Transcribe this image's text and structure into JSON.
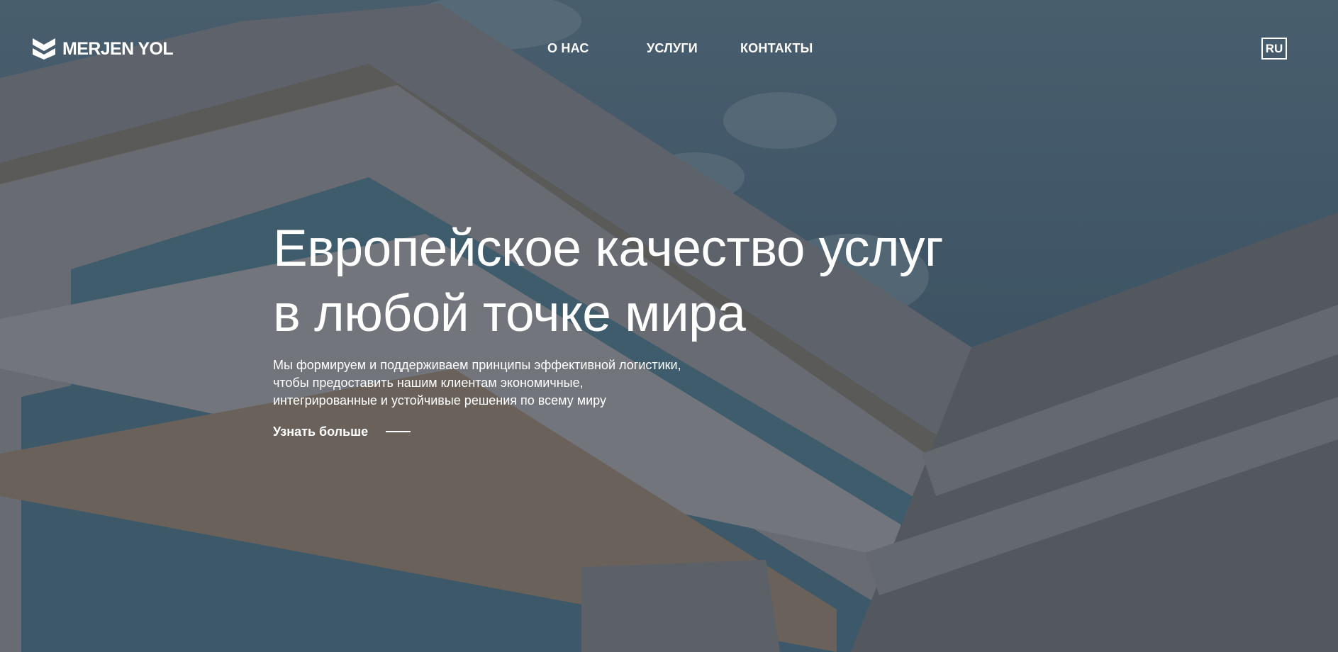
{
  "brand": {
    "name": "MERJEN YOL",
    "logo_icon": "chevron-stack-logo-icon"
  },
  "nav": {
    "items": [
      {
        "label": "О НАС"
      },
      {
        "label": "УСЛУГИ"
      },
      {
        "label": "КОНТАКТЫ"
      }
    ]
  },
  "language": {
    "current": "RU"
  },
  "hero": {
    "title_line1": "Европейское качество услуг",
    "title_line2": "в любой точке мира",
    "desc_line1": "Мы формируем и поддерживаем принципы эффективной логистики,",
    "desc_line2": "чтобы предоставить нашим клиентам экономичные,",
    "desc_line3": "интегрированные и устойчивые решения по всему миру",
    "cta_label": "Узнать больше"
  },
  "colors": {
    "overlay": "#1f2a36",
    "sky": "#4b6377",
    "text": "#ffffff",
    "glass": "#3f6e86"
  }
}
